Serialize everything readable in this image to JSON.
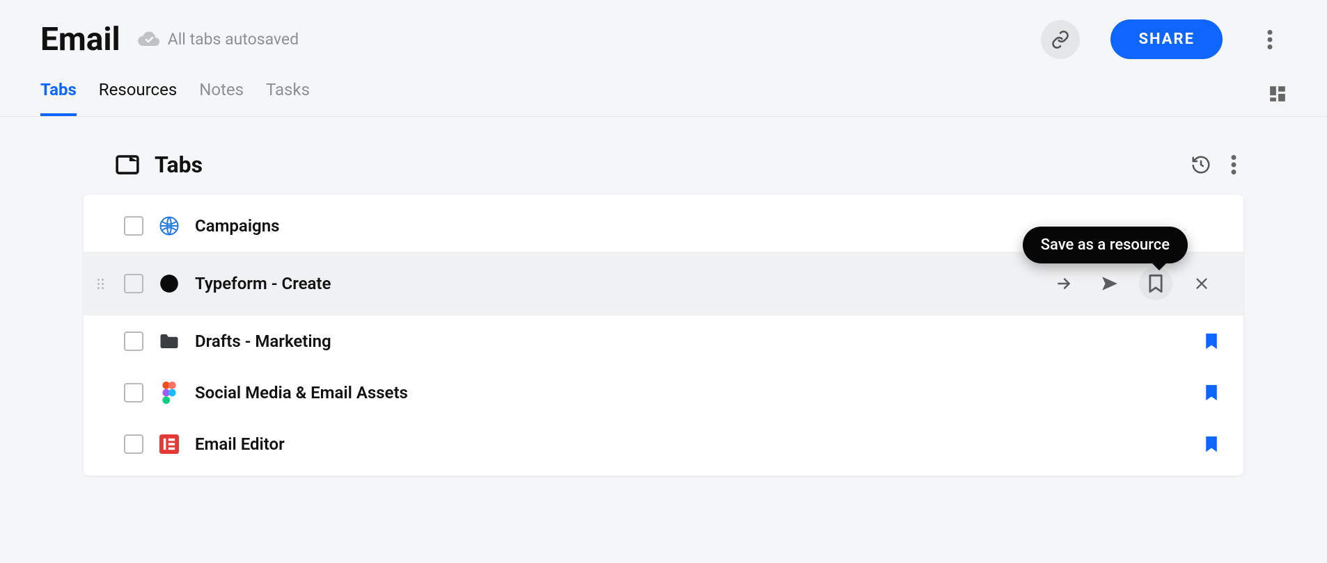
{
  "page": {
    "title": "Email",
    "autosave_text": "All tabs autosaved",
    "share_label": "SHARE"
  },
  "nav": {
    "tabs": [
      {
        "label": "Tabs",
        "active": true
      },
      {
        "label": "Resources",
        "active": false,
        "dark": true
      },
      {
        "label": "Notes",
        "active": false
      },
      {
        "label": "Tasks",
        "active": false
      }
    ]
  },
  "section": {
    "title": "Tabs"
  },
  "tooltip": {
    "save_resource": "Save as a resource"
  },
  "tabs_list": [
    {
      "title": "Campaigns",
      "icon": "openai",
      "bookmarked": false,
      "hovered": false
    },
    {
      "title": "Typeform - Create",
      "icon": "dot",
      "bookmarked": false,
      "hovered": true
    },
    {
      "title": "Drafts - Marketing",
      "icon": "folder",
      "bookmarked": true,
      "hovered": false
    },
    {
      "title": "Social Media & Email Assets",
      "icon": "figma",
      "bookmarked": true,
      "hovered": false
    },
    {
      "title": "Email Editor",
      "icon": "elementor",
      "bookmarked": true,
      "hovered": false
    }
  ]
}
